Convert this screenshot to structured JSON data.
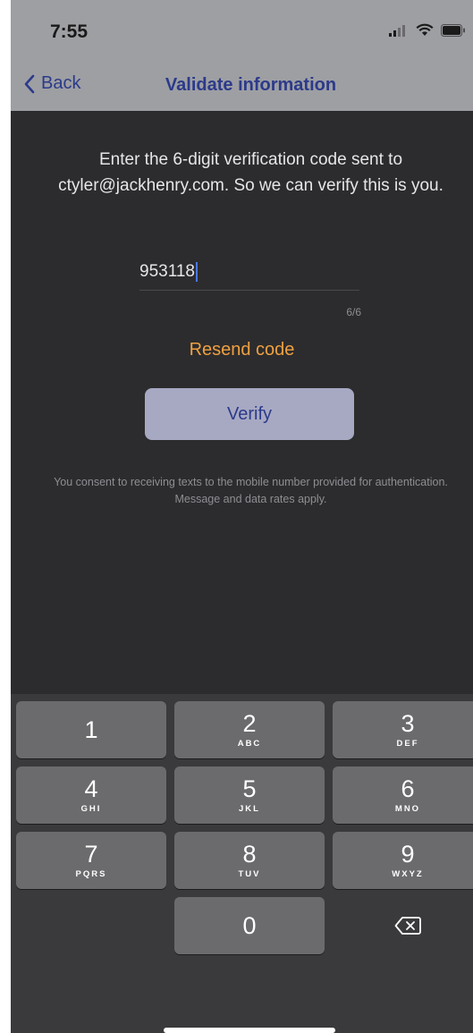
{
  "status_bar": {
    "time": "7:55"
  },
  "nav": {
    "back_label": "Back",
    "title": "Validate information"
  },
  "main": {
    "instructions": "Enter the 6-digit verification code sent to ctyler@jackhenry.com. So we can verify this is you.",
    "code_value": "953118",
    "counter": "6/6",
    "resend_label": "Resend code",
    "verify_label": "Verify",
    "consent": "You consent to receiving texts to the mobile number provided for authentication. Message and data rates apply."
  },
  "keyboard": {
    "keys": [
      {
        "num": "1",
        "letters": ""
      },
      {
        "num": "2",
        "letters": "ABC"
      },
      {
        "num": "3",
        "letters": "DEF"
      },
      {
        "num": "4",
        "letters": "GHI"
      },
      {
        "num": "5",
        "letters": "JKL"
      },
      {
        "num": "6",
        "letters": "MNO"
      },
      {
        "num": "7",
        "letters": "PQRS"
      },
      {
        "num": "8",
        "letters": "TUV"
      },
      {
        "num": "9",
        "letters": "WXYZ"
      },
      {
        "num": "0",
        "letters": ""
      }
    ],
    "delete_icon": "delete-backspace-icon"
  },
  "colors": {
    "header_bg": "#9e9fa3",
    "nav_text": "#2c3a8a",
    "screen_bg": "#2c2c2e",
    "resend": "#f0a040",
    "verify_bg": "#a7a9c3",
    "caret": "#4a74ff",
    "key_bg": "#6b6b6e",
    "keyboard_bg": "#3a3a3c"
  }
}
